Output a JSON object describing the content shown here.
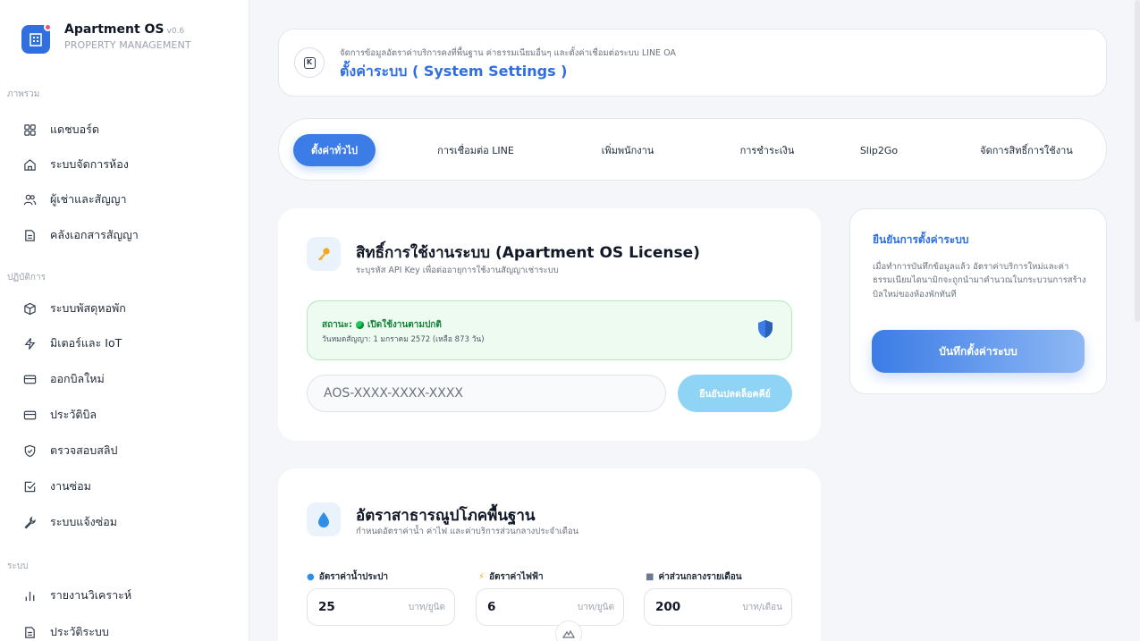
{
  "brand": {
    "name": "Apartment OS",
    "version": "v0.6",
    "subtitle": "PROPERTY MANAGEMENT"
  },
  "sidebar": {
    "sections": [
      {
        "title": "ภาพรวม"
      },
      {
        "title": "ปฏิบัติการ"
      },
      {
        "title": "ระบบ"
      }
    ],
    "items": [
      {
        "label": "แดชบอร์ด",
        "icon": "dashboard-icon"
      },
      {
        "label": "ระบบจัดการห้อง",
        "icon": "home-icon"
      },
      {
        "label": "ผู้เช่าและสัญญา",
        "icon": "users-icon"
      },
      {
        "label": "คลังเอกสารสัญญา",
        "icon": "document-icon"
      },
      {
        "label": "ระบบพัสดุหอพัก",
        "icon": "package-icon"
      },
      {
        "label": "มิเตอร์และ IoT",
        "icon": "lightning-icon"
      },
      {
        "label": "ออกบิลใหม่",
        "icon": "card-icon"
      },
      {
        "label": "ประวัติบิล",
        "icon": "card-icon"
      },
      {
        "label": "ตรวจสอบสลิป",
        "icon": "shield-check-icon"
      },
      {
        "label": "งานซ่อม",
        "icon": "checkbox-icon"
      },
      {
        "label": "ระบบแจ้งซ่อม",
        "icon": "wrench-icon"
      },
      {
        "label": "รายงานวิเคราะห์",
        "icon": "bar-chart-icon"
      },
      {
        "label": "ประวัติระบบ",
        "icon": "document-icon"
      }
    ]
  },
  "header": {
    "subtitle": "จัดการข้อมูลอัตราค่าบริการคงที่พื้นฐาน ค่าธรรมเนียมอื่นๆ และตั้งค่าเชื่อมต่อระบบ LINE OA",
    "title": "ตั้งค่าระบบ ( System Settings )"
  },
  "tabs": [
    {
      "label": "ตั้งค่าทั่วไป",
      "active": true
    },
    {
      "label": "การเชื่อมต่อ LINE",
      "active": false
    },
    {
      "label": "เพิ่มพนักงาน",
      "active": false
    },
    {
      "label": "การชำระเงิน",
      "active": false
    },
    {
      "label": "Slip2Go",
      "active": false
    },
    {
      "label": "จัดการสิทธิ์การใช้งาน",
      "active": false
    }
  ],
  "license": {
    "icon": "key-icon",
    "title": "สิทธิ์การใช้งานระบบ (Apartment OS License)",
    "subtitle": "ระบุรหัส API Key เพื่อต่ออายุการใช้งานสัญญาเช่าระบบ",
    "status_prefix": "สถานะ:",
    "status_text": "เปิดใช้งานตามปกติ",
    "expiry": "วันหมดสัญญา: 1 มกราคม 2572 (เหลือ 873 วัน)",
    "key_placeholder": "AOS-XXXX-XXXX-XXXX",
    "unlock_label": "ยืนยันปลดล็อคคีย์",
    "status_color": "#16803a"
  },
  "confirm": {
    "title": "ยืนยันการตั้งค่าระบบ",
    "text": "เมื่อทำการบันทึกข้อมูลแล้ว อัตราค่าบริการใหม่และค่าธรรมเนียมไดนามิกจะถูกนำมาคำนวณในกระบวนการสร้างบิลใหม่ของห้องพักทันที",
    "save_label": "บันทึกตั้งค่าระบบ"
  },
  "utility": {
    "icon": "water-drop-icon",
    "title": "อัตราสาธารณูปโภคพื้นฐาน",
    "subtitle": "กำหนดอัตราค่าน้ำ ค่าไฟ และค่าบริการส่วนกลางประจำเดือน",
    "fields": [
      {
        "label": "อัตราค่าน้ำประปา",
        "icon": "water-drop-icon",
        "value": "25",
        "unit": "บาท/ยูนิต"
      },
      {
        "label": "อัตราค่าไฟฟ้า",
        "icon": "lightning-icon",
        "value": "6",
        "unit": "บาท/ยูนิต"
      },
      {
        "label": "ค่าส่วนกลางรายเดือน",
        "icon": "building-icon",
        "value": "200",
        "unit": "บาท/เดือน"
      }
    ]
  },
  "colors": {
    "accent": "#2f6fe0",
    "tab_active": "#3b7ce6",
    "success": "#22c55e"
  }
}
